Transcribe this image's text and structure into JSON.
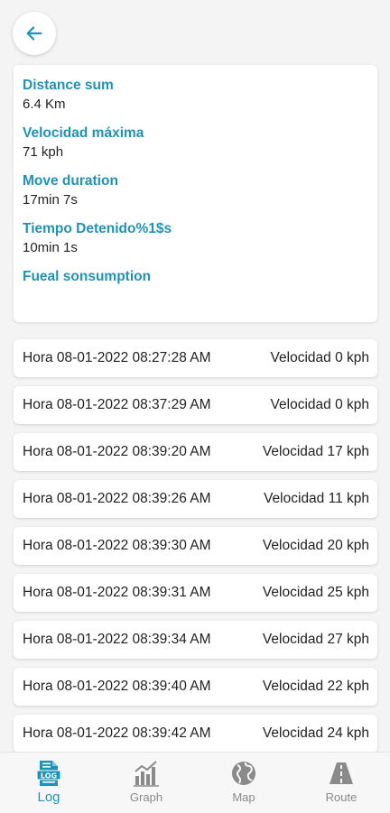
{
  "colors": {
    "accent": "#1e93b8",
    "inactive": "#8a8a8a",
    "text": "#222222"
  },
  "header": {
    "back_icon": "arrow-left-icon"
  },
  "summary": {
    "stats": [
      {
        "label": "Distance sum",
        "value": "6.4 Km"
      },
      {
        "label": "Velocidad máxima",
        "value": "71 kph"
      },
      {
        "label": "Move duration",
        "value": "17min 7s"
      },
      {
        "label": "Tiempo Detenido%1$s",
        "value": "10min 1s"
      },
      {
        "label": "Fueal sonsumption",
        "value": ""
      }
    ]
  },
  "log": {
    "rows": [
      {
        "time": "Hora 08-01-2022 08:27:28 AM",
        "speed": "Velocidad 0 kph"
      },
      {
        "time": "Hora 08-01-2022 08:37:29 AM",
        "speed": "Velocidad 0 kph"
      },
      {
        "time": "Hora 08-01-2022 08:39:20 AM",
        "speed": "Velocidad 17 kph"
      },
      {
        "time": "Hora 08-01-2022 08:39:26 AM",
        "speed": "Velocidad 11 kph"
      },
      {
        "time": "Hora 08-01-2022 08:39:30 AM",
        "speed": "Velocidad 20 kph"
      },
      {
        "time": "Hora 08-01-2022 08:39:31 AM",
        "speed": "Velocidad 25 kph"
      },
      {
        "time": "Hora 08-01-2022 08:39:34 AM",
        "speed": "Velocidad 27 kph"
      },
      {
        "time": "Hora 08-01-2022 08:39:40 AM",
        "speed": "Velocidad 22 kph"
      },
      {
        "time": "Hora 08-01-2022 08:39:42 AM",
        "speed": "Velocidad 24 kph"
      }
    ]
  },
  "nav": {
    "items": [
      {
        "label": "Log",
        "icon": "log-icon",
        "active": true
      },
      {
        "label": "Graph",
        "icon": "bar-chart-icon",
        "active": false
      },
      {
        "label": "Map",
        "icon": "globe-icon",
        "active": false
      },
      {
        "label": "Route",
        "icon": "road-icon",
        "active": false
      }
    ]
  }
}
